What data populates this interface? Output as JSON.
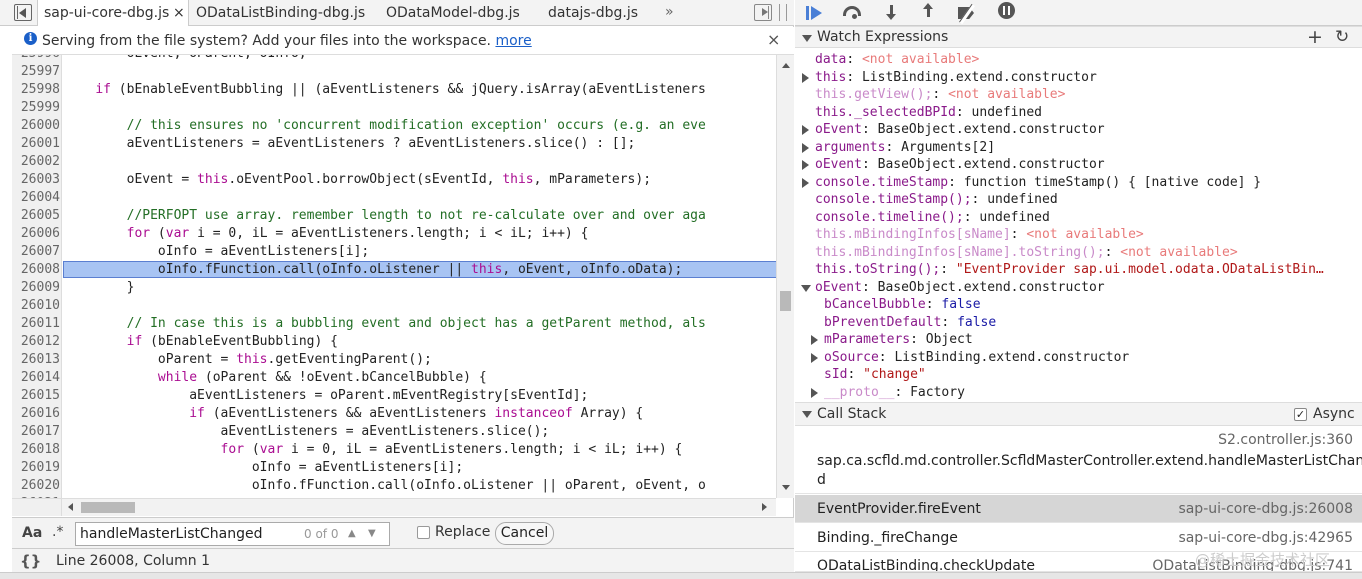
{
  "tabs": [
    {
      "label": "sap-ui-core-dbg.js",
      "active": true
    },
    {
      "label": "ODataListBinding-dbg.js"
    },
    {
      "label": "ODataModel-dbg.js"
    },
    {
      "label": "datajs-dbg.js"
    }
  ],
  "tab_close": "×",
  "tabs_overflow": "»",
  "infobar": {
    "icon": "info-icon",
    "text": "Serving from the file system? Add your files into the workspace.",
    "link": "more",
    "close": "×"
  },
  "editor": {
    "highlighted_line": "26008",
    "lines": [
      {
        "n": "25996",
        "html": "        oEvent, oParent, oInfo;"
      },
      {
        "n": "25997",
        "html": ""
      },
      {
        "n": "25998",
        "html": "    <span class=\"kw\">if</span> (bEnableEventBubbling || (aEventListeners &amp;&amp; jQuery.isArray(aEventListeners"
      },
      {
        "n": "25999",
        "html": ""
      },
      {
        "n": "26000",
        "html": "        <span class=\"cm\">// this ensures no 'concurrent modification exception' occurs (e.g. an eve</span>"
      },
      {
        "n": "26001",
        "html": "        aEventListeners = aEventListeners ? aEventListeners.slice() : [];"
      },
      {
        "n": "26002",
        "html": ""
      },
      {
        "n": "26003",
        "html": "        oEvent = <span class=\"kw\">this</span>.oEventPool.borrowObject(sEventId, <span class=\"kw\">this</span>, mParameters);"
      },
      {
        "n": "26004",
        "html": ""
      },
      {
        "n": "26005",
        "html": "        <span class=\"cm\">//PERFOPT use array. remember length to not re-calculate over and over aga</span>"
      },
      {
        "n": "26006",
        "html": "        <span class=\"kw\">for</span> (<span class=\"kw\">var</span> i = 0, iL = aEventListeners.length; i &lt; iL; i++) {"
      },
      {
        "n": "26007",
        "html": "            oInfo = aEventListeners[i];"
      },
      {
        "n": "26008",
        "html": "            oInfo.fFunction.call(oInfo.oListener || <span class=\"kw\">this</span>, oEvent, oInfo.oData);"
      },
      {
        "n": "26009",
        "html": "        }"
      },
      {
        "n": "26010",
        "html": ""
      },
      {
        "n": "26011",
        "html": "        <span class=\"cm\">// In case this is a bubbling event and object has a getParent method, als</span>"
      },
      {
        "n": "26012",
        "html": "        <span class=\"kw\">if</span> (bEnableEventBubbling) {"
      },
      {
        "n": "26013",
        "html": "            oParent = <span class=\"kw\">this</span>.getEventingParent();"
      },
      {
        "n": "26014",
        "html": "            <span class=\"kw\">while</span> (oParent &amp;&amp; !oEvent.bCancelBubble) {"
      },
      {
        "n": "26015",
        "html": "                aEventListeners = oParent.mEventRegistry[sEventId];"
      },
      {
        "n": "26016",
        "html": "                <span class=\"kw\">if</span> (aEventListeners &amp;&amp; aEventListeners <span class=\"kw\">instanceof</span> Array) {"
      },
      {
        "n": "26017",
        "html": "                    aEventListeners = aEventListeners.slice();"
      },
      {
        "n": "26018",
        "html": "                    <span class=\"kw\">for</span> (<span class=\"kw\">var</span> i = 0, iL = aEventListeners.length; i &lt; iL; i++) {"
      },
      {
        "n": "26019",
        "html": "                        oInfo = aEventListeners[i];"
      },
      {
        "n": "26020",
        "html": "                        oInfo.fFunction.call(oInfo.oListener || oParent, oEvent, o"
      },
      {
        "n": "26021",
        "html": ""
      }
    ]
  },
  "search": {
    "case_label": "Aa",
    "regex_label": ".*",
    "value": "handleMasterListChanged",
    "count": "0 of 0",
    "up": "▲",
    "down": "▼",
    "replace_label": "Replace",
    "cancel_label": "Cancel"
  },
  "status": {
    "braces": "{}",
    "text": "Line 26008, Column 1"
  },
  "watch": {
    "title": "Watch Expressions",
    "add": "+",
    "refresh": "↻",
    "items": [
      {
        "html": "<span class=\"wn\">data</span>: <span class=\"wval-na\">&lt;not available&gt;</span>",
        "indent": 20,
        "expand": false
      },
      {
        "html": "<span class=\"wn\">this</span>: ListBinding.extend.constructor",
        "indent": 20,
        "expand": true
      },
      {
        "html": "<span class=\"wna\">this.getView();</span>: <span class=\"wval-na\">&lt;not available&gt;</span>",
        "indent": 20,
        "expand": false
      },
      {
        "html": "<span class=\"wn\">this._selectedBPId</span>: undefined",
        "indent": 20,
        "expand": false
      },
      {
        "html": "<span class=\"wn\">oEvent</span>: BaseObject.extend.constructor",
        "indent": 20,
        "expand": true
      },
      {
        "html": "<span class=\"wn\">arguments</span>: Arguments[2]",
        "indent": 20,
        "expand": true
      },
      {
        "html": "<span class=\"wn\">oEvent</span>: BaseObject.extend.constructor",
        "indent": 20,
        "expand": true
      },
      {
        "html": "<span class=\"wn\">console.timeStamp</span>: function timeStamp() { [native code] }",
        "indent": 20,
        "expand": true
      },
      {
        "html": "<span class=\"wn\">console.timeStamp();</span>: undefined",
        "indent": 20,
        "expand": false
      },
      {
        "html": "<span class=\"wn\">console.timeline();</span>: undefined",
        "indent": 20,
        "expand": false
      },
      {
        "html": "<span class=\"wna\">this.mBindingInfos[sName]</span>: <span class=\"wval-na\">&lt;not available&gt;</span>",
        "indent": 20,
        "expand": false
      },
      {
        "html": "<span class=\"wna\">this.mBindingInfos[sName].toString();</span>: <span class=\"wval-na\">&lt;not available&gt;</span>",
        "indent": 20,
        "expand": false
      },
      {
        "html": "<span class=\"wn\">this.toString();</span>: <span class=\"wstr\">\"EventProvider sap.ui.model.odata.ODataListBin…</span>",
        "indent": 20,
        "expand": false
      },
      {
        "html": "<span class=\"wn\">oEvent</span>: BaseObject.extend.constructor",
        "indent": 20,
        "expand": "open"
      },
      {
        "html": "<span class=\"wn\">bCancelBubble</span>: <span class=\"wkw\">false</span>",
        "indent": 29,
        "expand": false
      },
      {
        "html": "<span class=\"wn\">bPreventDefault</span>: <span class=\"wkw\">false</span>",
        "indent": 29,
        "expand": false
      },
      {
        "html": "<span class=\"wn\">mParameters</span>: Object",
        "indent": 29,
        "expand": true
      },
      {
        "html": "<span class=\"wn\">oSource</span>: ListBinding.extend.constructor",
        "indent": 29,
        "expand": true
      },
      {
        "html": "<span class=\"wn\">sId</span>: <span class=\"wstr\">\"change\"</span>",
        "indent": 29,
        "expand": false
      },
      {
        "html": "<span class=\"wna\">__proto__</span>: Factory",
        "indent": 29,
        "expand": true
      }
    ]
  },
  "callstack": {
    "title": "Call Stack",
    "async_label": "Async",
    "async_checked": "✓",
    "frames": [
      {
        "loc": "S2.controller.js:360",
        "fn": "sap.ca.scfld.md.controller.ScfldMasterController.extend.handleMasterListChange",
        "fn2": "d"
      },
      {
        "fn": "EventProvider.fireEvent",
        "loc": "sap-ui-core-dbg.js:26008",
        "selected": true
      },
      {
        "fn": "Binding._fireChange",
        "loc": "sap-ui-core-dbg.js:42965"
      },
      {
        "fn": "ODataListBinding.checkUpdate",
        "loc": "ODataListBinding-dbg.js:741"
      }
    ]
  },
  "watermark": "@稀土掘金技术社区"
}
